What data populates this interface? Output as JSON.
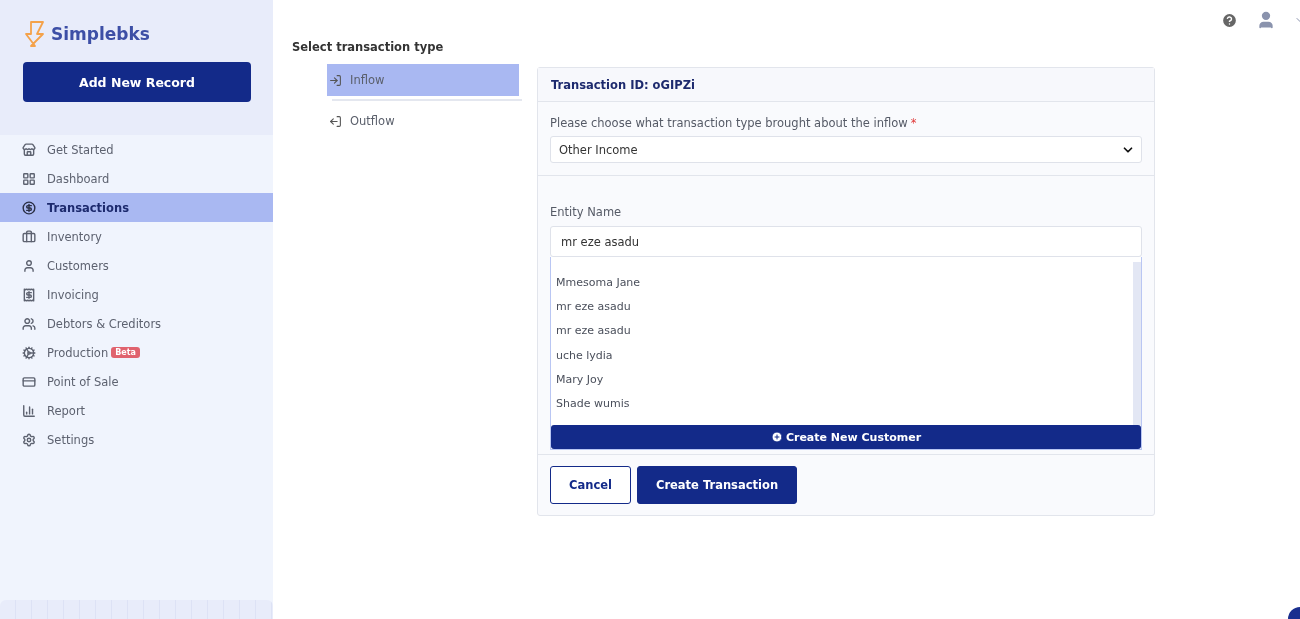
{
  "brand": {
    "name": "Simplebks"
  },
  "add_button": "Add New Record",
  "sidebar": {
    "items": [
      {
        "label": "Get Started",
        "selected": false
      },
      {
        "label": "Dashboard",
        "selected": false
      },
      {
        "label": "Transactions",
        "selected": true
      },
      {
        "label": "Inventory",
        "selected": false
      },
      {
        "label": "Customers",
        "selected": false
      },
      {
        "label": "Invoicing",
        "selected": false
      },
      {
        "label": "Debtors & Creditors",
        "selected": false
      },
      {
        "label": "Production",
        "selected": false,
        "badge": "Beta"
      },
      {
        "label": "Point of Sale",
        "selected": false
      },
      {
        "label": "Report",
        "selected": false
      },
      {
        "label": "Settings",
        "selected": false
      }
    ]
  },
  "type_picker": {
    "title": "Select transaction type",
    "options": [
      {
        "label": "Inflow",
        "kind": "in",
        "selected": true
      },
      {
        "label": "Outflow",
        "kind": "out",
        "selected": false
      }
    ]
  },
  "form": {
    "header": "Transaction ID: oGIPZi",
    "type_field": {
      "label": "Please choose what transaction type brought about the inflow",
      "required_mark": "*",
      "value": "Other Income"
    },
    "entity_field": {
      "label": "Entity Name",
      "value": "mr eze asadu"
    },
    "suggestions": [
      "Mmesoma Jane",
      "mr eze asadu",
      "mr eze asadu",
      "uche lydia",
      "Mary Joy",
      "Shade wumis"
    ],
    "create_customer": "Create New Customer",
    "buttons": [
      {
        "label": "Cancel",
        "kind": "secondary"
      },
      {
        "label": "Create Transaction",
        "kind": "primary"
      }
    ]
  }
}
